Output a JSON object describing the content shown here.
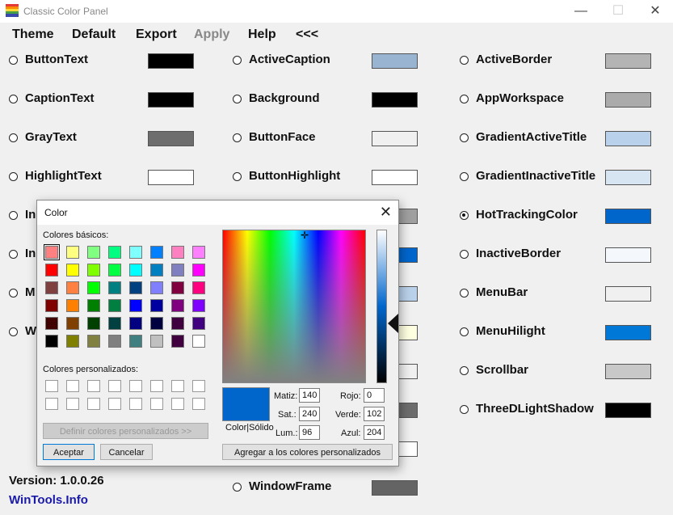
{
  "window": {
    "title": "Classic Color Panel",
    "minimize": "—",
    "maximize": "☐",
    "close": "✕"
  },
  "menu": [
    "Theme",
    "Default",
    "Export",
    "Apply",
    "Help",
    "<<<"
  ],
  "columns": [
    [
      {
        "label": "ButtonText",
        "color": "#000000",
        "checked": false
      },
      {
        "label": "CaptionText",
        "color": "#000000",
        "checked": false
      },
      {
        "label": "GrayText",
        "color": "#6d6d6d",
        "checked": false
      },
      {
        "label": "HighlightText",
        "color": "#ffffff",
        "checked": false
      },
      {
        "label": "In",
        "color": "",
        "checked": false
      },
      {
        "label": "In",
        "color": "",
        "checked": false
      },
      {
        "label": "M",
        "color": "",
        "checked": false
      },
      {
        "label": "W",
        "color": "",
        "checked": false
      }
    ],
    [
      {
        "label": "ActiveCaption",
        "color": "#99b4d1",
        "checked": false
      },
      {
        "label": "Background",
        "color": "#000000",
        "checked": false
      },
      {
        "label": "ButtonFace",
        "color": "#f0f0f0",
        "checked": false
      },
      {
        "label": "ButtonHighlight",
        "color": "#ffffff",
        "checked": false
      },
      {
        "label": "",
        "color": "#a0a0a0",
        "checked": false
      },
      {
        "label": "",
        "color": "#0066cc",
        "checked": false
      },
      {
        "label": "",
        "color": "#b9d1ea",
        "checked": false
      },
      {
        "label": "",
        "color": "#ffffe1",
        "checked": false
      },
      {
        "label": "",
        "color": "#f0f0f0",
        "checked": false
      },
      {
        "label": "",
        "color": "#6d6d6d",
        "checked": false
      },
      {
        "label": "",
        "color": "#ffffff",
        "checked": false
      },
      {
        "label": "WindowFrame",
        "color": "#646464",
        "checked": false
      }
    ],
    [
      {
        "label": "ActiveBorder",
        "color": "#b4b4b4",
        "checked": false
      },
      {
        "label": "AppWorkspace",
        "color": "#ababab",
        "checked": false
      },
      {
        "label": "GradientActiveTitle",
        "color": "#b9d1ea",
        "checked": false
      },
      {
        "label": "GradientInactiveTitle",
        "color": "#d7e4f2",
        "checked": false
      },
      {
        "label": "HotTrackingColor",
        "color": "#0066cc",
        "checked": true
      },
      {
        "label": "InactiveBorder",
        "color": "#f4f7fc",
        "checked": false
      },
      {
        "label": "MenuBar",
        "color": "#f0f0f0",
        "checked": false
      },
      {
        "label": "MenuHilight",
        "color": "#0078d7",
        "checked": false
      },
      {
        "label": "Scrollbar",
        "color": "#c8c8c8",
        "checked": false
      },
      {
        "label": "ThreeDLightShadow",
        "color": "#000000",
        "checked": false
      }
    ]
  ],
  "footer": {
    "version": "Version: 1.0.0.26",
    "link": "WinTools.Info"
  },
  "dialog": {
    "title": "Color",
    "close": "✕",
    "basic_label": "Colores básicos:",
    "custom_label": "Colores personalizados:",
    "basic_colors": [
      "#ff8080",
      "#ffff80",
      "#80ff80",
      "#00ff80",
      "#80ffff",
      "#0080ff",
      "#ff80c0",
      "#ff80ff",
      "#ff0000",
      "#ffff00",
      "#80ff00",
      "#00ff40",
      "#00ffff",
      "#0080c0",
      "#8080c0",
      "#ff00ff",
      "#804040",
      "#ff8040",
      "#00ff00",
      "#008080",
      "#004080",
      "#8080ff",
      "#800040",
      "#ff0080",
      "#800000",
      "#ff8000",
      "#008000",
      "#008040",
      "#0000ff",
      "#0000a0",
      "#800080",
      "#8000ff",
      "#400000",
      "#804000",
      "#004000",
      "#004040",
      "#000080",
      "#000040",
      "#400040",
      "#400080",
      "#000000",
      "#808000",
      "#808040",
      "#808080",
      "#408080",
      "#c0c0c0",
      "#400040",
      "#ffffff"
    ],
    "define_button": "Definir colores personalizados >>",
    "ok_button": "Aceptar",
    "cancel_button": "Cancelar",
    "add_button": "Agregar a los colores personalizados",
    "preview_label": "Color|Sólido",
    "preview_color": "#0066cc",
    "fields": [
      {
        "label": "Matiz:",
        "value": "140"
      },
      {
        "label": "Sat.:",
        "value": "240"
      },
      {
        "label": "Lum.:",
        "value": "96"
      },
      {
        "label": "Rojo:",
        "value": "0"
      },
      {
        "label": "Verde:",
        "value": "102"
      },
      {
        "label": "Azul:",
        "value": "204"
      }
    ]
  }
}
